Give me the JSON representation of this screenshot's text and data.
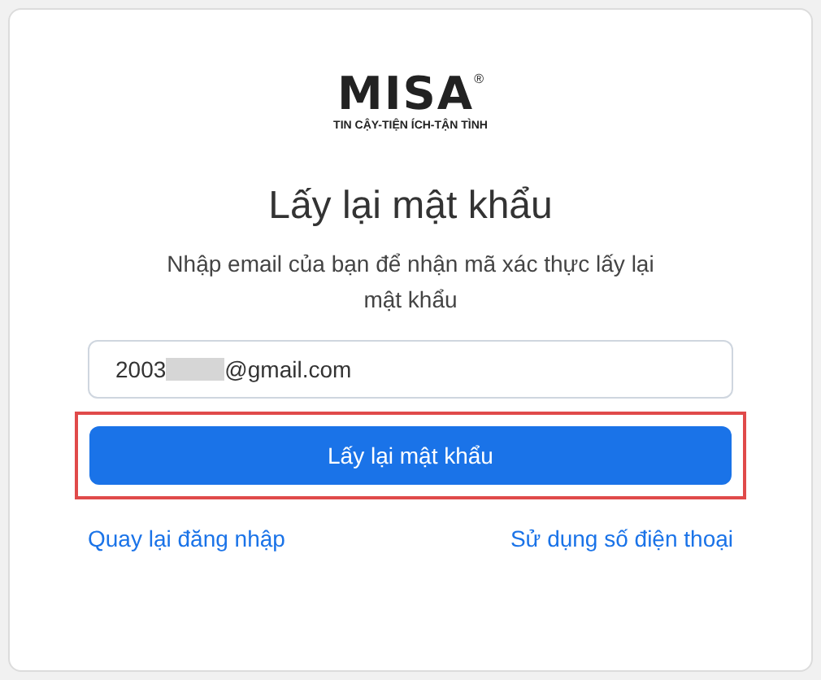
{
  "logo": {
    "wordmark": "MISA",
    "registered": "®",
    "tagline": "TIN CẬY-TIỆN ÍCH-TẬN TÌNH"
  },
  "title": "Lấy lại mật khẩu",
  "subtitle": "Nhập email của bạn để nhận mã xác thực lấy lại mật khẩu",
  "email": {
    "value_start": "2003",
    "redacted": true,
    "value_end": "@gmail.com"
  },
  "submit": {
    "label": "Lấy lại mật khẩu",
    "highlighted": true
  },
  "links": [
    {
      "label": "Quay lại đăng nhập"
    },
    {
      "label": "Sử dụng số điện thoại"
    }
  ]
}
